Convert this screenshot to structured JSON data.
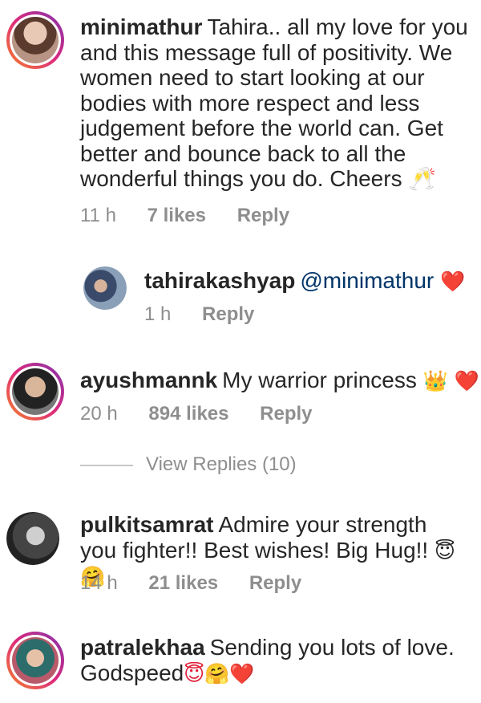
{
  "comments": [
    {
      "username": "minimathur",
      "text": "Tahira.. all my love for you and this message full of positivity. We women need to start looking at our bodies with more respect and less judgement before the world can. Get better and bounce back to all the wonderful things you do. Cheers 🥂",
      "time": "11 h",
      "likes": "7 likes",
      "reply_label": "Reply"
    },
    {
      "username": "tahirakashyap",
      "mention": "@minimathur",
      "emoji": "❤️",
      "time": "1 h",
      "reply_label": "Reply"
    },
    {
      "username": "ayushmannk",
      "text": "My warrior princess",
      "emoji": "👑 ❤️",
      "time": "20 h",
      "likes": "894 likes",
      "reply_label": "Reply"
    },
    {
      "username": "pulkitsamrat",
      "text": "Admire your strength you fighter!! Best wishes! Big Hug!!",
      "emoji": "😇🤗",
      "time": "14 h",
      "likes": "21 likes",
      "reply_label": "Reply"
    },
    {
      "username": "patralekhaa",
      "text": "Sending you lots of love. Godspeed",
      "emoji": "😇🤗❤️"
    }
  ],
  "view_replies": "View Replies (10)",
  "colors": {
    "text": "#262626",
    "meta": "#8e8e8e",
    "mention": "#003569",
    "story_ring": "#e1306c"
  }
}
